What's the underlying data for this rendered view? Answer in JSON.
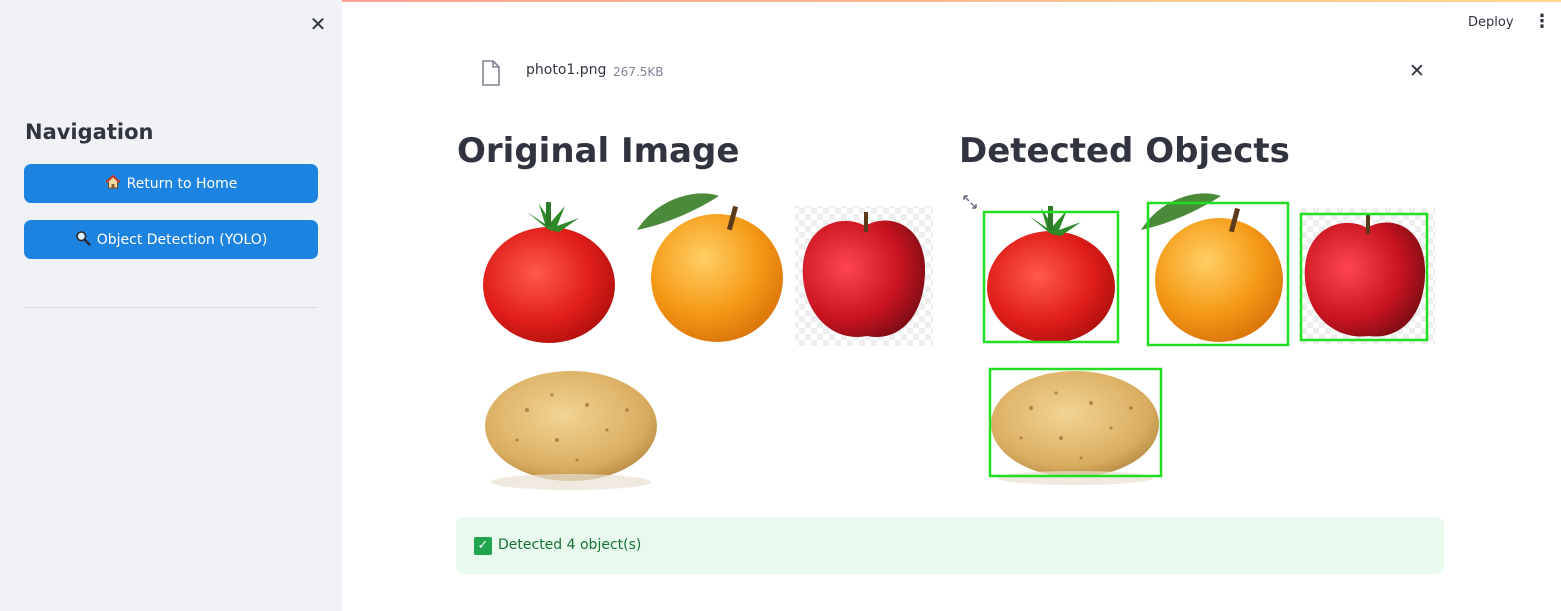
{
  "sidebar": {
    "close_icon": "close-icon",
    "title": "Navigation",
    "buttons": [
      {
        "label": "Return to Home",
        "icon": "house-icon"
      },
      {
        "label": "Object Detection (YOLO)",
        "icon": "magnifier-icon"
      }
    ]
  },
  "header": {
    "deploy_label": "Deploy",
    "menu_icon": "kebab-menu-icon"
  },
  "file": {
    "name": "photo1.png",
    "size": "267.5KB",
    "icon": "file-icon",
    "remove_icon": "close-icon"
  },
  "columns": {
    "original_title": "Original Image",
    "detected_title": "Detected Objects"
  },
  "images": {
    "items": [
      "tomato",
      "orange",
      "apple",
      "potato"
    ],
    "detection_box_color": "#22dd22"
  },
  "status": {
    "message": "Detected 4 object(s)",
    "icon": "check-icon",
    "accent": "#21a44f"
  },
  "colors": {
    "sidebar_bg": "#f0f2f6",
    "button_bg": "#1c83e1",
    "alert_bg": "#e8f9ee"
  }
}
